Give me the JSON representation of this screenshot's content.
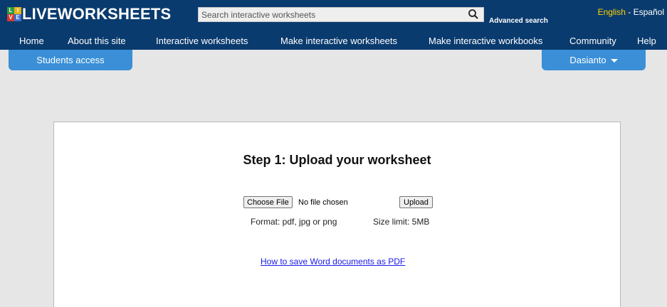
{
  "header": {
    "logo": {
      "grid_letters": [
        "L",
        "I",
        "V",
        "E"
      ],
      "text": "LIVEWORKSHEETS"
    },
    "search": {
      "placeholder": "Search interactive worksheets",
      "advanced_label": "Advanced search"
    },
    "languages": {
      "english": "English",
      "separator": " - ",
      "spanish": "Español"
    }
  },
  "nav": {
    "items": [
      "Home",
      "About this site",
      "Interactive worksheets",
      "Make interactive worksheets",
      "Make interactive workbooks",
      "Community",
      "Help"
    ]
  },
  "tabs": {
    "students": "Students access",
    "user": "Dasianto"
  },
  "main": {
    "title": "Step 1: Upload your worksheet",
    "choose_file_label": "Choose File",
    "no_file_text": "No file chosen",
    "upload_label": "Upload",
    "format_text": "Format: pdf, jpg or png",
    "size_limit_text": "Size limit: 5MB",
    "pdf_link_text": "How to save Word documents as PDF"
  },
  "colors": {
    "header_bg": "#0a3b6e",
    "tab_bg": "#3a8fd6",
    "page_bg": "#e6e6e6",
    "english_active": "#ffd400",
    "link": "#1a1ae6",
    "logo_grid": [
      "#2e9b3f",
      "#e8b21c",
      "#d6372f",
      "#3b6fc8"
    ]
  },
  "icons": {
    "search": "magnifier-icon",
    "user_menu": "caret-down-icon"
  }
}
